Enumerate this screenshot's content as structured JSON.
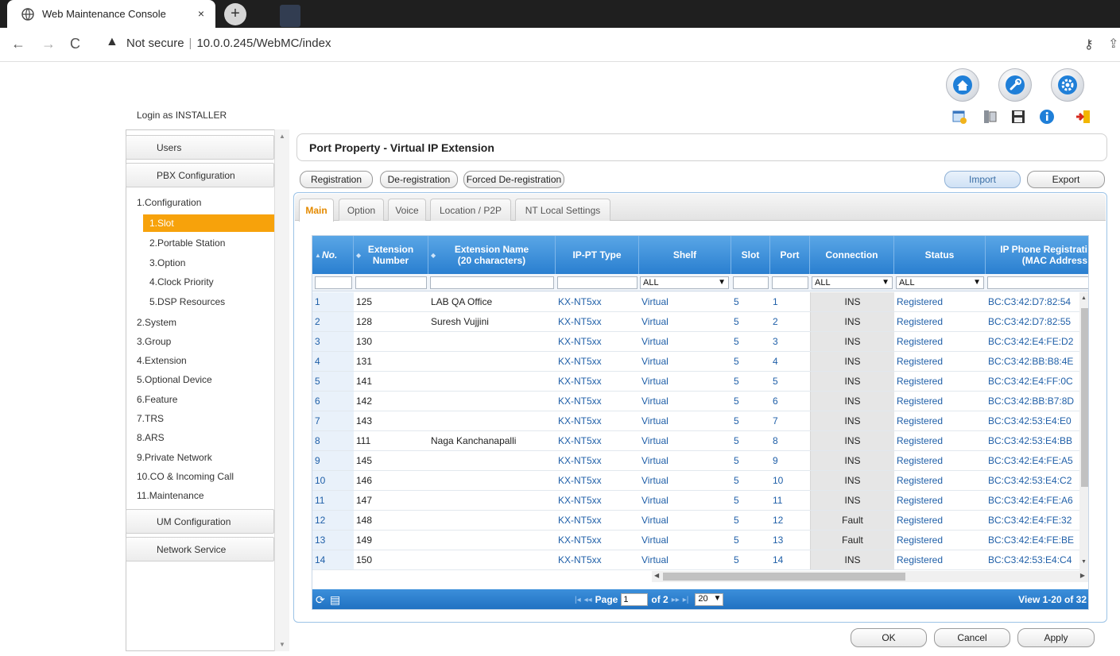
{
  "browser": {
    "tab_title": "Web Maintenance Console",
    "tab_close": "×",
    "new_tab": "+",
    "security_label": "Not secure",
    "url": "10.0.0.245/WebMC/index"
  },
  "header": {
    "login_text": "Login as INSTALLER",
    "top_icons": [
      "home-icon",
      "wrench-icon",
      "gear-icon"
    ],
    "small_icons": [
      "window-warning-icon",
      "phone-list-icon",
      "save-icon",
      "info-icon",
      "logout-icon"
    ]
  },
  "sidebar": {
    "users": "Users",
    "pbx": "PBX Configuration",
    "configuration": "1.Configuration",
    "config_items": [
      "1.Slot",
      "2.Portable Station",
      "3.Option",
      "4.Clock Priority",
      "5.DSP Resources"
    ],
    "sections": [
      "2.System",
      "3.Group",
      "4.Extension",
      "5.Optional Device",
      "6.Feature",
      "7.TRS",
      "8.ARS",
      "9.Private Network",
      "10.CO & Incoming Call",
      "11.Maintenance"
    ],
    "um": "UM Configuration",
    "network": "Network Service"
  },
  "main": {
    "title": "Port Property - Virtual IP Extension",
    "buttons": {
      "registration": "Registration",
      "deregistration": "De-registration",
      "forced": "Forced De-registration",
      "import": "Import",
      "export": "Export"
    },
    "tabs": [
      "Main",
      "Option",
      "Voice",
      "Location / P2P",
      "NT Local Settings"
    ]
  },
  "grid": {
    "headers": [
      "No.",
      "Extension Number",
      "Extension Name (20 characters)",
      "IP-PT Type",
      "Shelf",
      "Slot",
      "Port",
      "Connection",
      "Status",
      "IP Phone Registrati (MAC Address"
    ],
    "filters": {
      "shelf": "ALL",
      "connection": "ALL",
      "status": "ALL"
    },
    "rows": [
      [
        "1",
        "125",
        "LAB QA Office",
        "KX-NT5xx",
        "Virtual",
        "5",
        "1",
        "INS",
        "Registered",
        "BC:C3:42:D7:82:54"
      ],
      [
        "2",
        "128",
        "Suresh Vujjini",
        "KX-NT5xx",
        "Virtual",
        "5",
        "2",
        "INS",
        "Registered",
        "BC:C3:42:D7:82:55"
      ],
      [
        "3",
        "130",
        "",
        "KX-NT5xx",
        "Virtual",
        "5",
        "3",
        "INS",
        "Registered",
        "BC:C3:42:E4:FE:D2"
      ],
      [
        "4",
        "131",
        "",
        "KX-NT5xx",
        "Virtual",
        "5",
        "4",
        "INS",
        "Registered",
        "BC:C3:42:BB:B8:4E"
      ],
      [
        "5",
        "141",
        "",
        "KX-NT5xx",
        "Virtual",
        "5",
        "5",
        "INS",
        "Registered",
        "BC:C3:42:E4:FF:0C"
      ],
      [
        "6",
        "142",
        "",
        "KX-NT5xx",
        "Virtual",
        "5",
        "6",
        "INS",
        "Registered",
        "BC:C3:42:BB:B7:8D"
      ],
      [
        "7",
        "143",
        "",
        "KX-NT5xx",
        "Virtual",
        "5",
        "7",
        "INS",
        "Registered",
        "BC:C3:42:53:E4:E0"
      ],
      [
        "8",
        "111",
        "Naga Kanchanapalli",
        "KX-NT5xx",
        "Virtual",
        "5",
        "8",
        "INS",
        "Registered",
        "BC:C3:42:53:E4:BB"
      ],
      [
        "9",
        "145",
        "",
        "KX-NT5xx",
        "Virtual",
        "5",
        "9",
        "INS",
        "Registered",
        "BC:C3:42:E4:FE:A5"
      ],
      [
        "10",
        "146",
        "",
        "KX-NT5xx",
        "Virtual",
        "5",
        "10",
        "INS",
        "Registered",
        "BC:C3:42:53:E4:C2"
      ],
      [
        "11",
        "147",
        "",
        "KX-NT5xx",
        "Virtual",
        "5",
        "11",
        "INS",
        "Registered",
        "BC:C3:42:E4:FE:A6"
      ],
      [
        "12",
        "148",
        "",
        "KX-NT5xx",
        "Virtual",
        "5",
        "12",
        "Fault",
        "Registered",
        "BC:C3:42:E4:FE:32"
      ],
      [
        "13",
        "149",
        "",
        "KX-NT5xx",
        "Virtual",
        "5",
        "13",
        "Fault",
        "Registered",
        "BC:C3:42:E4:FE:BE"
      ],
      [
        "14",
        "150",
        "",
        "KX-NT5xx",
        "Virtual",
        "5",
        "14",
        "INS",
        "Registered",
        "BC:C3:42:53:E4:C4"
      ]
    ],
    "pager": {
      "page_label": "Page",
      "page_value": "1",
      "of_label": "of 2",
      "page_size": "20",
      "view_text": "View 1-20 of 32"
    }
  },
  "footer": {
    "ok": "OK",
    "cancel": "Cancel",
    "apply": "Apply"
  }
}
